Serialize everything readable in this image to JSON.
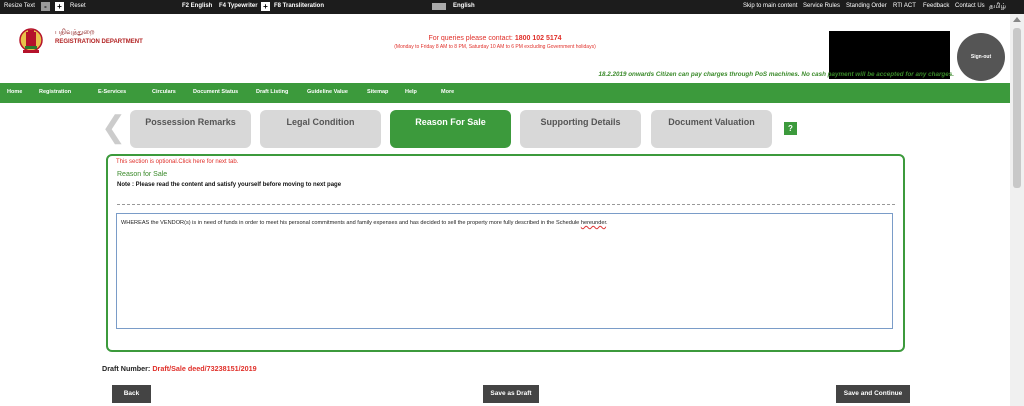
{
  "topbar": {
    "resize_text": "Resize Text",
    "minus": "-",
    "plus": "+",
    "reset": "Reset",
    "f2": "F2 English",
    "f4": "F4 Typewriter",
    "f4_box": "+",
    "f8": "F8 Transliteration",
    "lang": "English",
    "skip": "Skip to main content",
    "service_rules": "Service Rules",
    "standing_order": "Standing Order",
    "rti": "RTI ACT",
    "feedback": "Feedback",
    "contact": "Contact Us",
    "tamil": "தமிழ்"
  },
  "header": {
    "dept_tamil": "பதிவுத்துறை",
    "dept_english": "REGISTRATION DEPARTMENT",
    "queries_prefix": "For queries please contact:",
    "queries_number": "1800 102 5174",
    "hours": "(Monday to Friday 8 AM to 8 PM, Saturday 10 AM to 6 PM excluding Government holidays)",
    "signout": "Sign-out",
    "notice": "18.2.2019 onwards Citizen can pay charges through PoS machines. No cash payment will be accepted for any charges."
  },
  "nav": [
    "Home",
    "Registration",
    "E-Services",
    "Circulars",
    "Document Status",
    "Draft Listing",
    "Guideline Value",
    "Sitemap",
    "Help",
    "More"
  ],
  "tabs": [
    {
      "label": "Possession Remarks",
      "active": false
    },
    {
      "label": "Legal Condition",
      "active": false
    },
    {
      "label": "Reason For Sale",
      "active": true
    },
    {
      "label": "Supporting Details",
      "active": false
    },
    {
      "label": "Document Valuation",
      "active": false
    }
  ],
  "help_label": "?",
  "panel": {
    "optional": "This section is optional.Click here for next tab.",
    "title": "Reason for Sale",
    "note": "Note : Please read the content and satisfy yourself before moving to next page",
    "text_main": "WHEREAS the VENDOR(s) is in need of funds in order to meet his personal commitments and family expenses and has decided to sell the property more fully described in the Schedule ",
    "text_underlined": "hereunder",
    "text_end": "."
  },
  "draft": {
    "label": "Draft Number:",
    "value": "Draft/Sale deed/73238151/2019"
  },
  "buttons": {
    "back": "Back",
    "save_draft": "Save as Draft",
    "save_continue": "Save and Continue"
  },
  "colors": {
    "green": "#3c9a3c",
    "red": "#e0302a",
    "topbar": "#1c1c1c"
  }
}
